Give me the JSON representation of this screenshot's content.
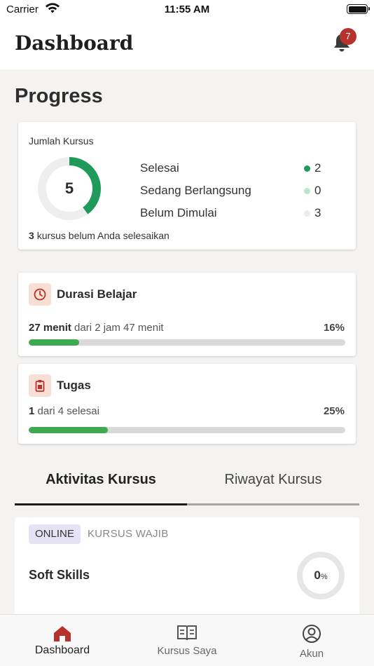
{
  "status_bar": {
    "carrier": "Carrier",
    "time": "11:55 AM"
  },
  "header": {
    "title": "Dashboard",
    "notification_count": "7"
  },
  "progress": {
    "title": "Progress",
    "courses_card": {
      "label": "Jumlah Kursus",
      "total": "5",
      "completed_fraction": 0.4,
      "legend": [
        {
          "name": "Selesai",
          "value": "2",
          "color": "#1f9a5a"
        },
        {
          "name": "Sedang Berlangsung",
          "value": "0",
          "color": "#b9e6c9"
        },
        {
          "name": "Belum Dimulai",
          "value": "3",
          "color": "#ececec"
        }
      ],
      "summary_count": "3",
      "summary_text": "kursus belum Anda selesaikan"
    },
    "duration_card": {
      "title": "Durasi Belajar",
      "value": "27 menit",
      "of_text": "dari 2 jam 47 menit",
      "percent_label": "16%",
      "fraction": 0.16
    },
    "tasks_card": {
      "title": "Tugas",
      "value": "1",
      "of_text": "dari 4 selesai",
      "percent_label": "25%",
      "fraction": 0.25
    }
  },
  "tabs": [
    {
      "label": "Aktivitas Kursus",
      "active": true
    },
    {
      "label": "Riwayat Kursus",
      "active": false
    }
  ],
  "course": {
    "mode": "ONLINE",
    "type": "KURSUS WAJIB",
    "name": "Soft Skills",
    "progress_value": "0",
    "progress_unit": "%"
  },
  "bottom_nav": [
    {
      "label": "Dashboard",
      "icon": "home-icon",
      "active": true
    },
    {
      "label": "Kursus Saya",
      "icon": "book-icon",
      "active": false
    },
    {
      "label": "Akun",
      "icon": "account-icon",
      "active": false
    }
  ],
  "colors": {
    "accent_red": "#b7322a",
    "progress_green": "#3eaa50",
    "donut_green": "#1f9a5a",
    "chip_purple": "#e6e2f5"
  }
}
